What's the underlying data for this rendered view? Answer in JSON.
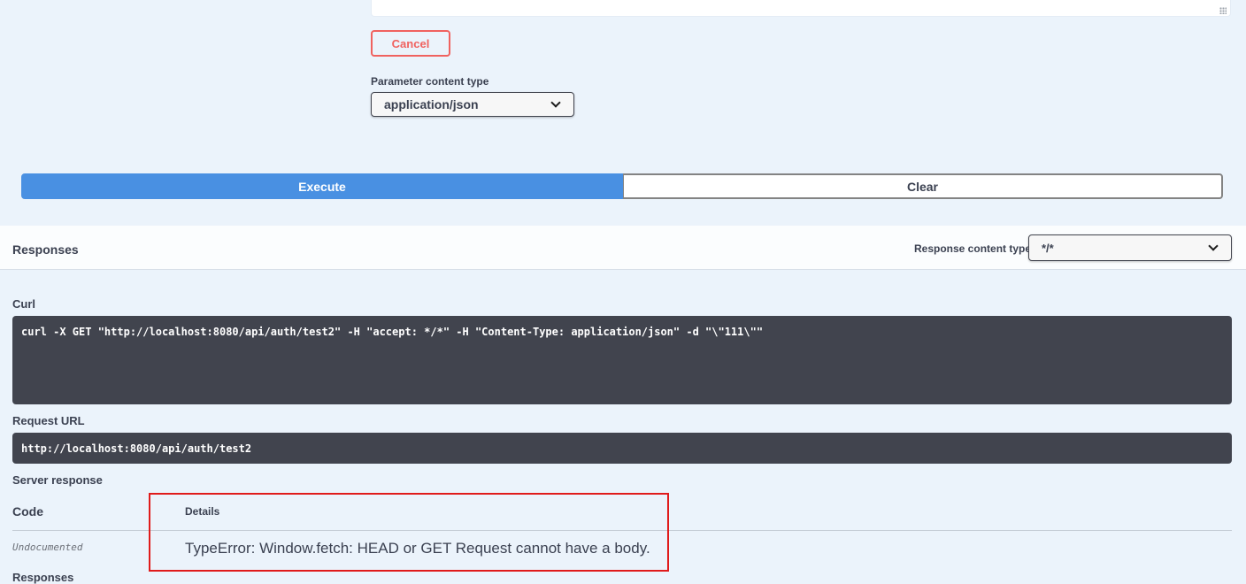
{
  "parameters": {
    "cancel_label": "Cancel",
    "content_type_label": "Parameter content type",
    "content_type_value": "application/json"
  },
  "actions": {
    "execute_label": "Execute",
    "clear_label": "Clear"
  },
  "responses": {
    "title": "Responses",
    "content_type_label": "Response content type",
    "content_type_value": "*/*",
    "curl_label": "Curl",
    "curl_command": "curl -X GET \"http://localhost:8080/api/auth/test2\" -H \"accept: */*\" -H \"Content-Type: application/json\" -d \"\\\"111\\\"\"",
    "request_url_label": "Request URL",
    "request_url": "http://localhost:8080/api/auth/test2",
    "server_response_label": "Server response",
    "code_header": "Code",
    "details_header": "Details",
    "code_value": "Undocumented",
    "error_message": "TypeError: Window.fetch: HEAD or GET Request cannot have a body.",
    "responses_sub_label": "Responses"
  },
  "colors": {
    "background": "#ebf3fb",
    "execute": "#4990e2",
    "cancel": "#f0625f",
    "code_block": "#41444e",
    "highlight_box": "#e01b1b"
  }
}
